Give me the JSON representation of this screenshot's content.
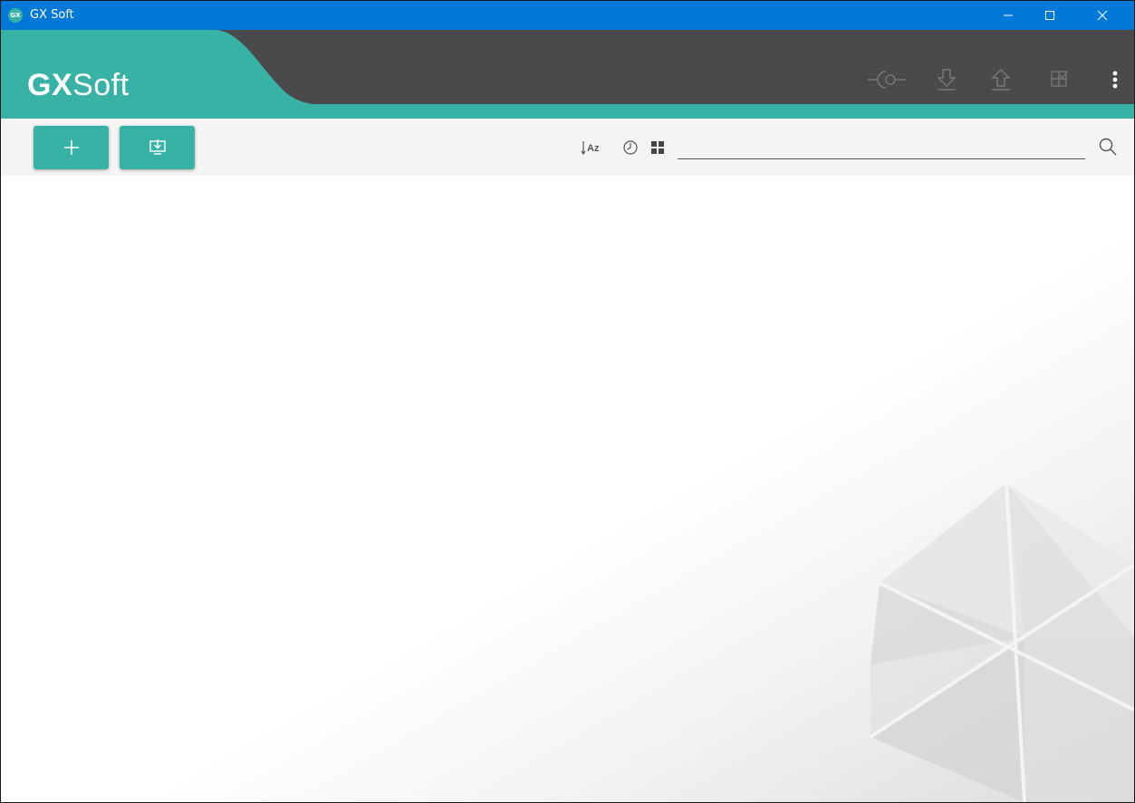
{
  "window": {
    "title": "GX Soft",
    "icon_text": "GX"
  },
  "header": {
    "logo_bold": "GX",
    "logo_light": "Soft",
    "accent": "#37b2a4",
    "dark": "#4a4a4a"
  },
  "toolbar": {
    "sort_icon_text": "Az",
    "search": {
      "value": "",
      "placeholder": ""
    }
  },
  "colors": {
    "titlebar": "#0078d7",
    "accent": "#37b2a4"
  },
  "icons": [
    "connect-icon",
    "download-icon",
    "upload-icon",
    "modules-icon",
    "more-vertical-icon",
    "add-icon",
    "import-screen-icon",
    "sort-az-icon",
    "clock-icon",
    "grid-view-icon",
    "search-icon"
  ]
}
